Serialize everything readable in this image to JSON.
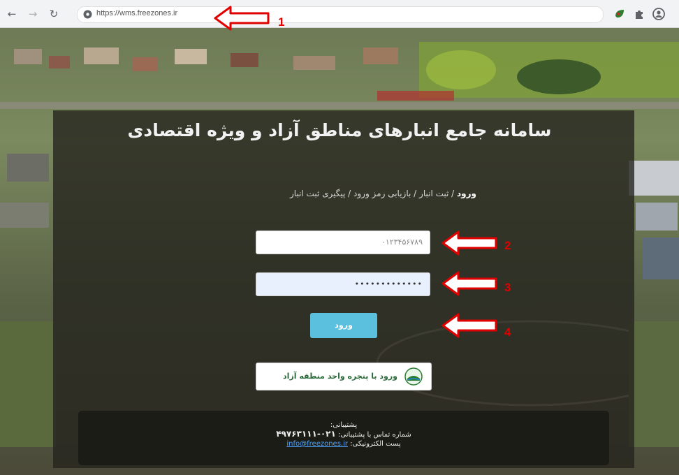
{
  "browser": {
    "url": "https://wms.freezones.ir",
    "back_icon": "back-arrow-icon",
    "forward_icon": "forward-arrow-icon",
    "reload_icon": "reload-icon"
  },
  "page": {
    "title": "سامانه جامع انبارهای مناطق آزاد و ویژه اقتصادی",
    "nav": {
      "login": "ورود",
      "sep": " / ",
      "register": "ثبت انبار",
      "recover": "بازیابی رمز ورود",
      "track": "پیگیری ثبت انبار"
    },
    "username_value": "۰۱۲۳۴۵۶۷۸۹",
    "password_value": "•••••••••••••",
    "login_button": "ورود",
    "freezone_button": "ورود با پنجره واحد منطقه آزاد",
    "support": {
      "heading": "پشتیبانی:",
      "phone_label": "شماره تماس با پشتیبانی:",
      "phone": "۰۲۱-۴۹۷۶۳۱۱۱",
      "email_label": "پست الکترونیکی:",
      "email": "info@freezones.ir"
    }
  },
  "annotations": {
    "labels": [
      "1",
      "2",
      "3",
      "4"
    ],
    "color": "#e10000"
  },
  "colors": {
    "panel": "#26241e",
    "login_button": "#5bc0de",
    "password_autofill": "#e8f0fe"
  }
}
